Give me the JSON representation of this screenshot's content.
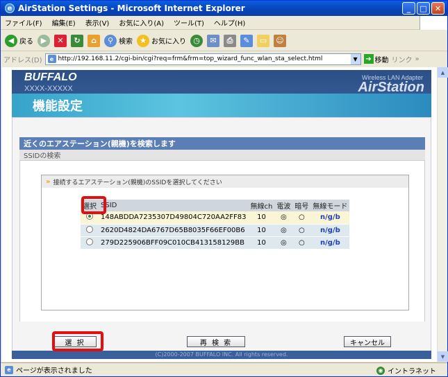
{
  "window": {
    "title": "AirStation Settings - Microsoft Internet Explorer"
  },
  "menu": [
    "ファイル(F)",
    "編集(E)",
    "表示(V)",
    "お気に入り(A)",
    "ツール(T)",
    "ヘルプ(H)"
  ],
  "toolbar": {
    "back": "戻る",
    "search": "検索",
    "favorites": "お気に入り"
  },
  "address": {
    "label": "アドレス(D)",
    "url": "http://192.168.11.2/cgi-bin/cgi?req=frm&frm=top_wizard_func_wlan_sta_select.html",
    "go": "移動",
    "links": "リンク"
  },
  "header": {
    "brand": "BUFFALO",
    "model": "XXXX-XXXXX",
    "product_line": "Wireless LAN Adapter",
    "product": "AirStation",
    "page_title": "機能設定"
  },
  "section": {
    "title": "近くのエアステーション(親機)を検索します",
    "subtitle": "SSIDの検索"
  },
  "panel": {
    "instruction": "接続するエアステーション(親機)のSSIDを選択してください"
  },
  "table": {
    "headers": [
      "選択",
      "SSID",
      "無線ch",
      "電波",
      "暗号",
      "無線モード"
    ],
    "rows": [
      {
        "selected": true,
        "ssid": "148ABDDA7235307D49804C720AA2FF83",
        "ch": "10",
        "signal": "◎",
        "enc": "○",
        "mode": "n/g/b"
      },
      {
        "selected": false,
        "ssid": "2620D4824DA6767D65B8035F66EF00B6",
        "ch": "10",
        "signal": "◎",
        "enc": "○",
        "mode": "n/g/b"
      },
      {
        "selected": false,
        "ssid": "279D225906BFF09C010CB413158129BB",
        "ch": "10",
        "signal": "◎",
        "enc": "○",
        "mode": "n/g/b"
      }
    ]
  },
  "buttons": {
    "select": "選 択",
    "rescan": "再 検 索",
    "cancel": "キャンセル"
  },
  "footer": "(C)2000-2007 BUFFALO INC. All rights reserved.",
  "status": {
    "text": "ページが表示されました",
    "zone": "イントラネット"
  }
}
